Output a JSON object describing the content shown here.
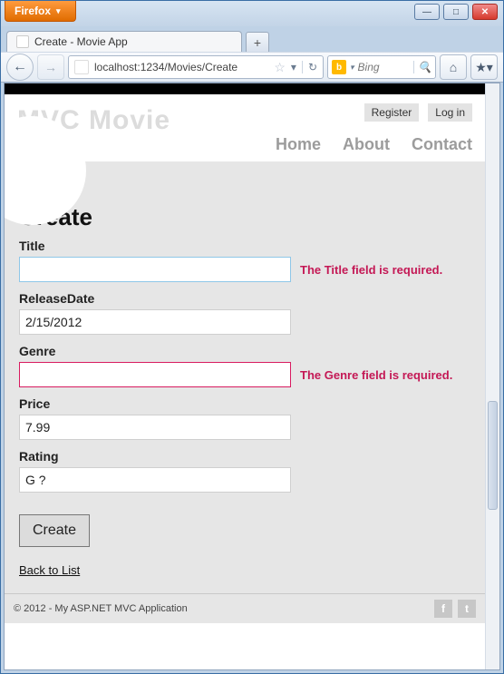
{
  "browser": {
    "menu_label": "Firefox",
    "tab_title": "Create - Movie App",
    "url": "localhost:1234/Movies/Create",
    "search_placeholder": "Bing"
  },
  "header": {
    "brand": "MVC Movie",
    "register": "Register",
    "login": "Log in",
    "nav": {
      "home": "Home",
      "about": "About",
      "contact": "Contact"
    }
  },
  "page": {
    "title": "Create",
    "fields": {
      "title": {
        "label": "Title",
        "value": "",
        "error": "The Title field is required."
      },
      "release": {
        "label": "ReleaseDate",
        "value": "2/15/2012",
        "error": ""
      },
      "genre": {
        "label": "Genre",
        "value": "",
        "error": "The Genre field is required."
      },
      "price": {
        "label": "Price",
        "value": "7.99",
        "error": ""
      },
      "rating": {
        "label": "Rating",
        "value": "G ?",
        "error": ""
      }
    },
    "submit": "Create",
    "back_link": "Back to List"
  },
  "footer": {
    "text": "© 2012 - My ASP.NET MVC Application"
  }
}
